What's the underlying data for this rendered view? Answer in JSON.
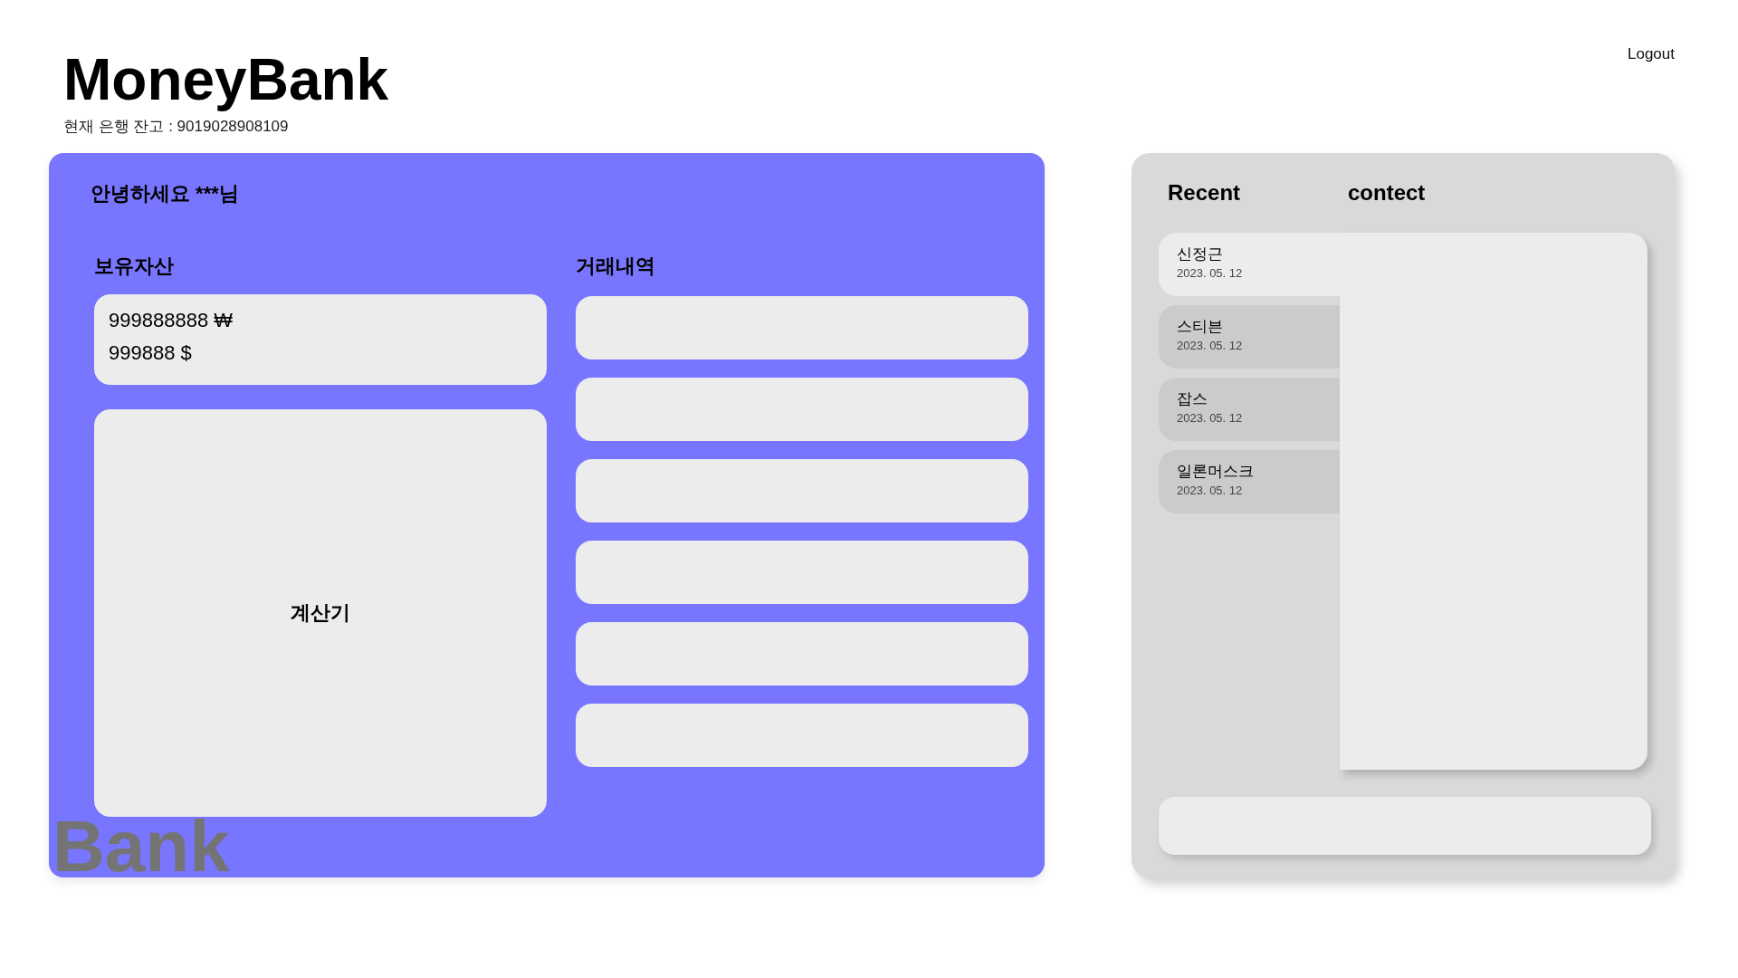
{
  "header": {
    "title": "MoneyBank",
    "balance_label": "현재 은행 잔고 : 9019028908109",
    "logout": "Logout"
  },
  "main_card": {
    "greeting": "안녕하세요 ***님",
    "decor_text": "Bank",
    "assets": {
      "title": "보유자산",
      "lines": [
        "999888888 ₩",
        "999888 $"
      ]
    },
    "calculator": {
      "label": "계산기"
    },
    "transactions": {
      "title": "거래내역",
      "rows": [
        {
          "kind": "empty"
        },
        {
          "kind": "empty"
        },
        {
          "kind": "empty"
        },
        {
          "kind": "empty"
        },
        {
          "kind": "empty"
        },
        {
          "kind": "empty"
        }
      ]
    }
  },
  "side_card": {
    "headers": [
      "Recent",
      "contect"
    ],
    "contacts": [
      {
        "name": "신정근",
        "date": "2023. 05. 12",
        "selected": true
      },
      {
        "name": "스티븐",
        "date": "2023. 05. 12",
        "selected": false
      },
      {
        "name": "잡스",
        "date": "2023. 05. 12",
        "selected": false
      },
      {
        "name": "일론머스크",
        "date": "2023. 05. 12",
        "selected": false
      }
    ]
  }
}
